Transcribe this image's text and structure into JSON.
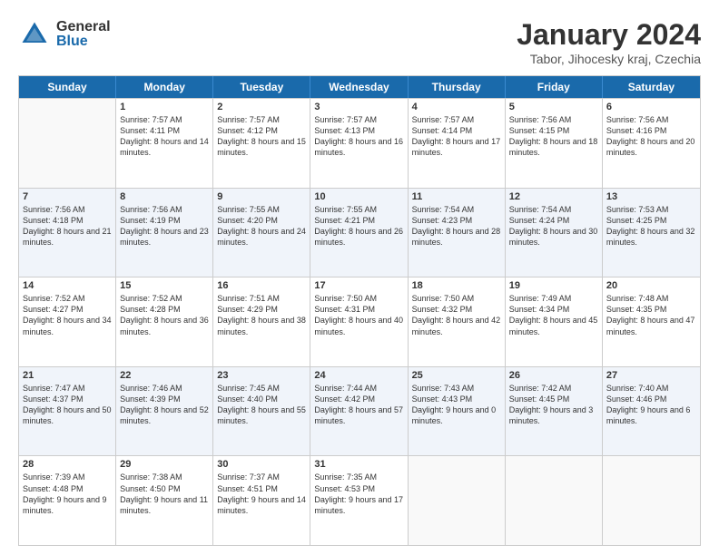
{
  "logo": {
    "general": "General",
    "blue": "Blue"
  },
  "title": "January 2024",
  "subtitle": "Tabor, Jihocesky kraj, Czechia",
  "days": [
    "Sunday",
    "Monday",
    "Tuesday",
    "Wednesday",
    "Thursday",
    "Friday",
    "Saturday"
  ],
  "weeks": [
    [
      {
        "day": "",
        "sunrise": "",
        "sunset": "",
        "daylight": "",
        "empty": true
      },
      {
        "day": "1",
        "sunrise": "Sunrise: 7:57 AM",
        "sunset": "Sunset: 4:11 PM",
        "daylight": "Daylight: 8 hours and 14 minutes."
      },
      {
        "day": "2",
        "sunrise": "Sunrise: 7:57 AM",
        "sunset": "Sunset: 4:12 PM",
        "daylight": "Daylight: 8 hours and 15 minutes."
      },
      {
        "day": "3",
        "sunrise": "Sunrise: 7:57 AM",
        "sunset": "Sunset: 4:13 PM",
        "daylight": "Daylight: 8 hours and 16 minutes."
      },
      {
        "day": "4",
        "sunrise": "Sunrise: 7:57 AM",
        "sunset": "Sunset: 4:14 PM",
        "daylight": "Daylight: 8 hours and 17 minutes."
      },
      {
        "day": "5",
        "sunrise": "Sunrise: 7:56 AM",
        "sunset": "Sunset: 4:15 PM",
        "daylight": "Daylight: 8 hours and 18 minutes."
      },
      {
        "day": "6",
        "sunrise": "Sunrise: 7:56 AM",
        "sunset": "Sunset: 4:16 PM",
        "daylight": "Daylight: 8 hours and 20 minutes."
      }
    ],
    [
      {
        "day": "7",
        "sunrise": "Sunrise: 7:56 AM",
        "sunset": "Sunset: 4:18 PM",
        "daylight": "Daylight: 8 hours and 21 minutes."
      },
      {
        "day": "8",
        "sunrise": "Sunrise: 7:56 AM",
        "sunset": "Sunset: 4:19 PM",
        "daylight": "Daylight: 8 hours and 23 minutes."
      },
      {
        "day": "9",
        "sunrise": "Sunrise: 7:55 AM",
        "sunset": "Sunset: 4:20 PM",
        "daylight": "Daylight: 8 hours and 24 minutes."
      },
      {
        "day": "10",
        "sunrise": "Sunrise: 7:55 AM",
        "sunset": "Sunset: 4:21 PM",
        "daylight": "Daylight: 8 hours and 26 minutes."
      },
      {
        "day": "11",
        "sunrise": "Sunrise: 7:54 AM",
        "sunset": "Sunset: 4:23 PM",
        "daylight": "Daylight: 8 hours and 28 minutes."
      },
      {
        "day": "12",
        "sunrise": "Sunrise: 7:54 AM",
        "sunset": "Sunset: 4:24 PM",
        "daylight": "Daylight: 8 hours and 30 minutes."
      },
      {
        "day": "13",
        "sunrise": "Sunrise: 7:53 AM",
        "sunset": "Sunset: 4:25 PM",
        "daylight": "Daylight: 8 hours and 32 minutes."
      }
    ],
    [
      {
        "day": "14",
        "sunrise": "Sunrise: 7:52 AM",
        "sunset": "Sunset: 4:27 PM",
        "daylight": "Daylight: 8 hours and 34 minutes."
      },
      {
        "day": "15",
        "sunrise": "Sunrise: 7:52 AM",
        "sunset": "Sunset: 4:28 PM",
        "daylight": "Daylight: 8 hours and 36 minutes."
      },
      {
        "day": "16",
        "sunrise": "Sunrise: 7:51 AM",
        "sunset": "Sunset: 4:29 PM",
        "daylight": "Daylight: 8 hours and 38 minutes."
      },
      {
        "day": "17",
        "sunrise": "Sunrise: 7:50 AM",
        "sunset": "Sunset: 4:31 PM",
        "daylight": "Daylight: 8 hours and 40 minutes."
      },
      {
        "day": "18",
        "sunrise": "Sunrise: 7:50 AM",
        "sunset": "Sunset: 4:32 PM",
        "daylight": "Daylight: 8 hours and 42 minutes."
      },
      {
        "day": "19",
        "sunrise": "Sunrise: 7:49 AM",
        "sunset": "Sunset: 4:34 PM",
        "daylight": "Daylight: 8 hours and 45 minutes."
      },
      {
        "day": "20",
        "sunrise": "Sunrise: 7:48 AM",
        "sunset": "Sunset: 4:35 PM",
        "daylight": "Daylight: 8 hours and 47 minutes."
      }
    ],
    [
      {
        "day": "21",
        "sunrise": "Sunrise: 7:47 AM",
        "sunset": "Sunset: 4:37 PM",
        "daylight": "Daylight: 8 hours and 50 minutes."
      },
      {
        "day": "22",
        "sunrise": "Sunrise: 7:46 AM",
        "sunset": "Sunset: 4:39 PM",
        "daylight": "Daylight: 8 hours and 52 minutes."
      },
      {
        "day": "23",
        "sunrise": "Sunrise: 7:45 AM",
        "sunset": "Sunset: 4:40 PM",
        "daylight": "Daylight: 8 hours and 55 minutes."
      },
      {
        "day": "24",
        "sunrise": "Sunrise: 7:44 AM",
        "sunset": "Sunset: 4:42 PM",
        "daylight": "Daylight: 8 hours and 57 minutes."
      },
      {
        "day": "25",
        "sunrise": "Sunrise: 7:43 AM",
        "sunset": "Sunset: 4:43 PM",
        "daylight": "Daylight: 9 hours and 0 minutes."
      },
      {
        "day": "26",
        "sunrise": "Sunrise: 7:42 AM",
        "sunset": "Sunset: 4:45 PM",
        "daylight": "Daylight: 9 hours and 3 minutes."
      },
      {
        "day": "27",
        "sunrise": "Sunrise: 7:40 AM",
        "sunset": "Sunset: 4:46 PM",
        "daylight": "Daylight: 9 hours and 6 minutes."
      }
    ],
    [
      {
        "day": "28",
        "sunrise": "Sunrise: 7:39 AM",
        "sunset": "Sunset: 4:48 PM",
        "daylight": "Daylight: 9 hours and 9 minutes."
      },
      {
        "day": "29",
        "sunrise": "Sunrise: 7:38 AM",
        "sunset": "Sunset: 4:50 PM",
        "daylight": "Daylight: 9 hours and 11 minutes."
      },
      {
        "day": "30",
        "sunrise": "Sunrise: 7:37 AM",
        "sunset": "Sunset: 4:51 PM",
        "daylight": "Daylight: 9 hours and 14 minutes."
      },
      {
        "day": "31",
        "sunrise": "Sunrise: 7:35 AM",
        "sunset": "Sunset: 4:53 PM",
        "daylight": "Daylight: 9 hours and 17 minutes."
      },
      {
        "day": "",
        "sunrise": "",
        "sunset": "",
        "daylight": "",
        "empty": true
      },
      {
        "day": "",
        "sunrise": "",
        "sunset": "",
        "daylight": "",
        "empty": true
      },
      {
        "day": "",
        "sunrise": "",
        "sunset": "",
        "daylight": "",
        "empty": true
      }
    ]
  ]
}
